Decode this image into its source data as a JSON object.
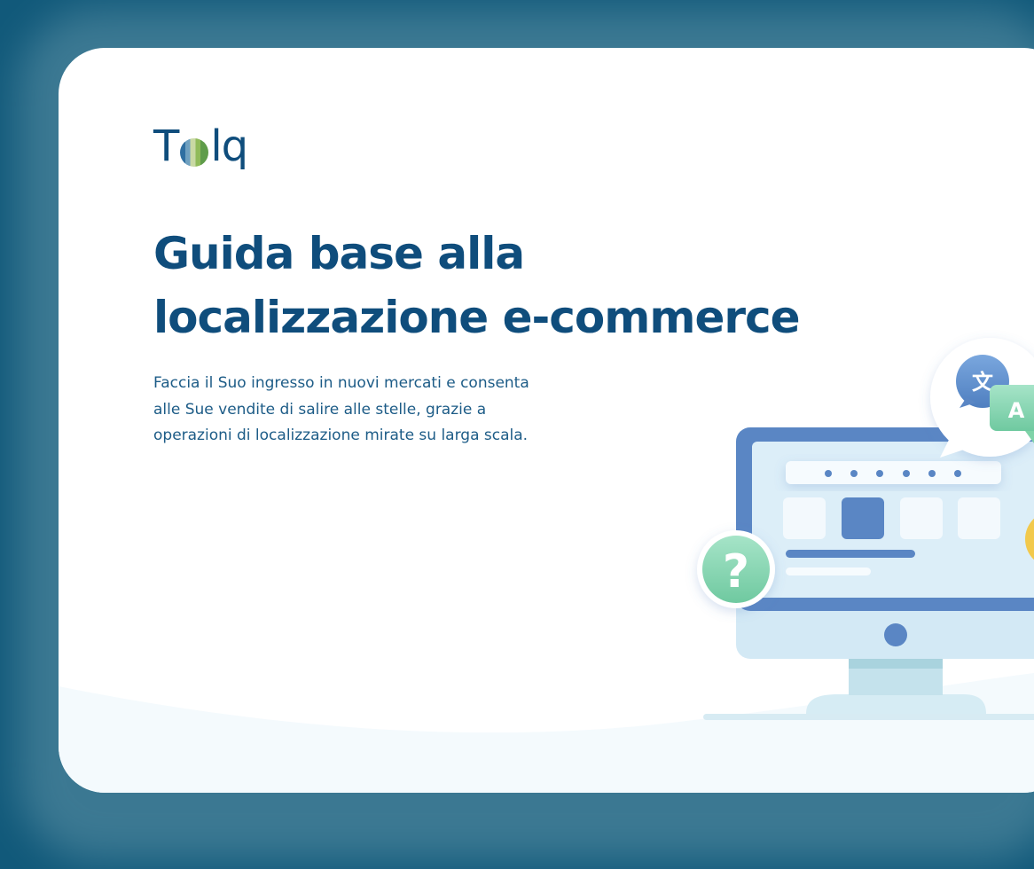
{
  "logo": {
    "text_before": "T",
    "text_after": "lq"
  },
  "heading": {
    "line1": "Guida base alla",
    "line2": "localizzazione e-commerce"
  },
  "subtitle": {
    "line1": "Faccia il Suo ingresso in nuovi mercati e consenta",
    "line2": "alle Sue vendite di salire alle stelle, grazie a",
    "line3": "operazioni di localizzazione mirate su larga scala."
  },
  "illustration": {
    "translate_glyph": "文",
    "letter_glyph": "A",
    "question_glyph": "?",
    "monitor_icon": "monitor-icon",
    "colors": {
      "brand_blue": "#0f4d7c",
      "monitor_frame": "#5a86c4",
      "screen": "#dceef8",
      "green_badge": "#7fd3a8"
    }
  }
}
